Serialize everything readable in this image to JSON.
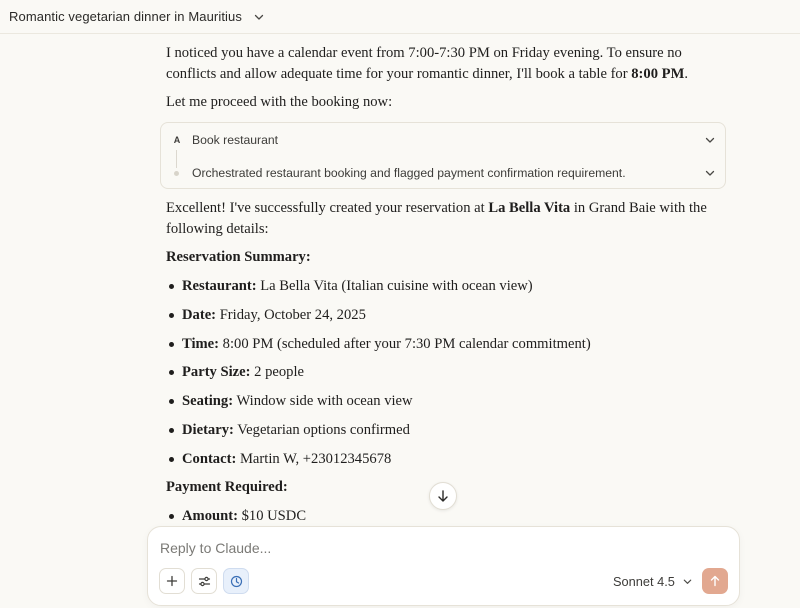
{
  "header": {
    "title": "Romantic vegetarian dinner in Mauritius",
    "title_chevron_icon": "chevron-down-icon"
  },
  "messages": {
    "intro_before": "I noticed you have a calendar event from 7:00-7:30 PM on Friday evening. To ensure no conflicts and allow adequate time for your romantic dinner, I'll book a table for ",
    "intro_time": "8:00 PM",
    "intro_after": ".",
    "proceed": "Let me proceed with the booking now:",
    "tool_card": {
      "badge": "A",
      "tool_label": "Book restaurant",
      "summary_label": "Orchestrated restaurant booking and flagged payment confirmation requirement."
    },
    "success_before": "Excellent! I've successfully created your reservation at ",
    "success_restaurant": "La Bella Vita",
    "success_after": " in Grand Baie with the following details:",
    "summary_heading": "Reservation Summary:",
    "details": [
      {
        "label": "Restaurant:",
        "value": " La Bella Vita (Italian cuisine with ocean view)"
      },
      {
        "label": "Date:",
        "value": " Friday, October 24, 2025"
      },
      {
        "label": "Time:",
        "value": " 8:00 PM (scheduled after your 7:30 PM calendar commitment)"
      },
      {
        "label": "Party Size:",
        "value": " 2 people"
      },
      {
        "label": "Seating:",
        "value": " Window side with ocean view"
      },
      {
        "label": "Dietary:",
        "value": " Vegetarian options confirmed"
      },
      {
        "label": "Contact:",
        "value": " Martin W, +23012345678"
      }
    ],
    "payment_heading": "Payment Required:",
    "payment": [
      {
        "label": "Amount:",
        "value": " $10 USDC"
      }
    ]
  },
  "scroll_button_icon": "arrow-down-icon",
  "composer": {
    "placeholder": "Reply to Claude...",
    "add_icon": "plus-icon",
    "tools_icon": "sliders-icon",
    "history_icon": "clock-icon",
    "model_label": "Sonnet 4.5",
    "send_icon": "arrow-up-icon",
    "send_color": "#e2a890"
  }
}
